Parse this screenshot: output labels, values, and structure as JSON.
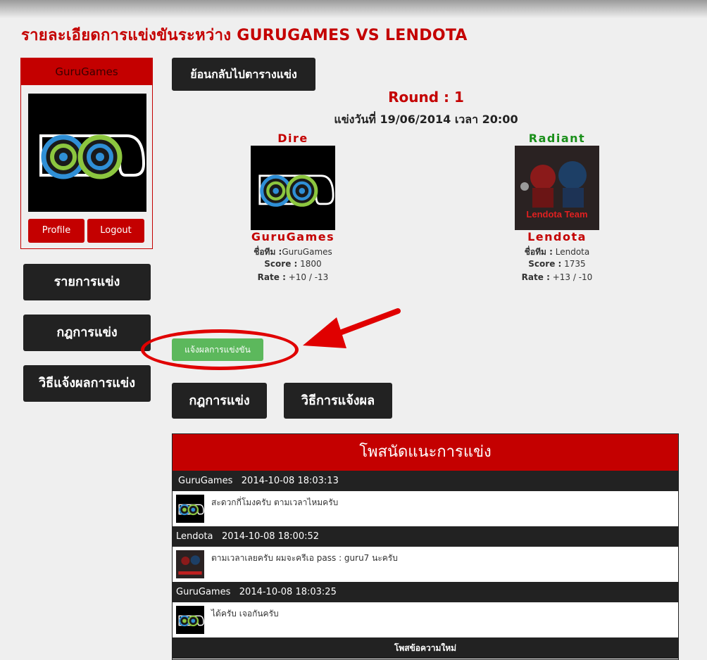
{
  "page_title": "รายละเอียดการแข่งขันระหว่าง GURUGAMES VS LENDOTA",
  "sidebar": {
    "team_name": "GuruGames",
    "profile_label": "Profile",
    "logout_label": "Logout",
    "items": [
      {
        "label": "รายการแข่ง"
      },
      {
        "label": "กฎการแข่ง"
      },
      {
        "label": "วิธีแจ้งผลการแข่ง"
      }
    ]
  },
  "match": {
    "back_label": "ย้อนกลับไปตารางแข่ง",
    "round": "Round : 1",
    "date": "แข่งวันที่ 19/06/2014 เวลา 20:00",
    "team1": {
      "side": "Dire",
      "name": "GuruGames",
      "team_label": "ชื่อทีม :",
      "team_value": "GuruGames",
      "score_label": "Score :",
      "score_value": "1800",
      "rate_label": "Rate :",
      "rate_value": "+10 / -13"
    },
    "team2": {
      "side": "Radiant",
      "name": "Lendota",
      "team_label": "ชื่อทีม :",
      "team_value": "Lendota",
      "score_label": "Score :",
      "score_value": "1735",
      "rate_label": "Rate :",
      "rate_value": "+13 / -10",
      "logo_text": "Lendota Team"
    },
    "report_label": "แจ้งผลการแข่งขัน",
    "rules_label": "กฎการแข่ง",
    "howto_label": "วิธีการแจ้งผล"
  },
  "chat": {
    "title": "โพสนัดแนะการแข่ง",
    "messages": [
      {
        "author": "GuruGames",
        "time": "2014-10-08 18:03:13",
        "text": "สะดวกกี่โมงครับ ตามเวลาไหมครับ"
      },
      {
        "author": "Lendota",
        "time": "2014-10-08 18:00:52",
        "text": "ตามเวลาเลยครับ ผมจะครีเอ pass : guru7 นะครับ"
      },
      {
        "author": "GuruGames",
        "time": "2014-10-08 18:03:25",
        "text": "ได้ครับ เจอกันครับ"
      }
    ],
    "new_post_label": "โพสข้อความใหม่"
  },
  "colors": {
    "brand_red": "#c40000",
    "dark": "#222222",
    "success": "#5cb85c",
    "dire": "#c40000",
    "radiant": "#1a8f1a"
  }
}
